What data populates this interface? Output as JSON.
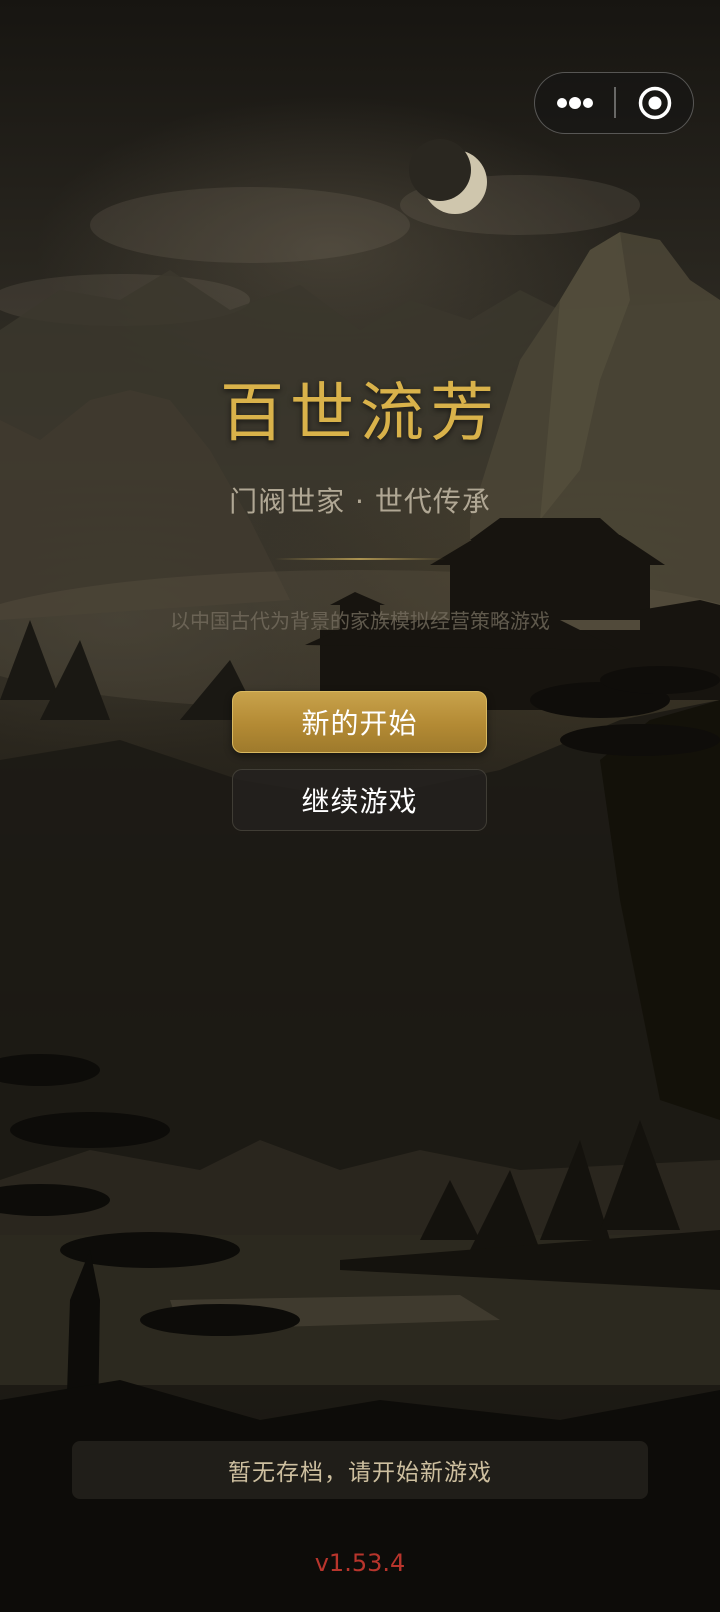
{
  "capsule": {
    "more_icon": "more-dots-icon",
    "close_icon": "target-circle-icon"
  },
  "hero": {
    "title": "百世流芳",
    "subtitle": "门阀世家 · 世代传承",
    "description": "以中国古代为背景的家族模拟经营策略游戏"
  },
  "menu": {
    "new_game_label": "新的开始",
    "continue_label": "继续游戏"
  },
  "save_notice": "暂无存档，请开始新游戏",
  "version": "v1.53.4",
  "colors": {
    "title_gold": "#d9b24a",
    "primary_button": "#b38a34",
    "version_red": "#b8352c"
  }
}
